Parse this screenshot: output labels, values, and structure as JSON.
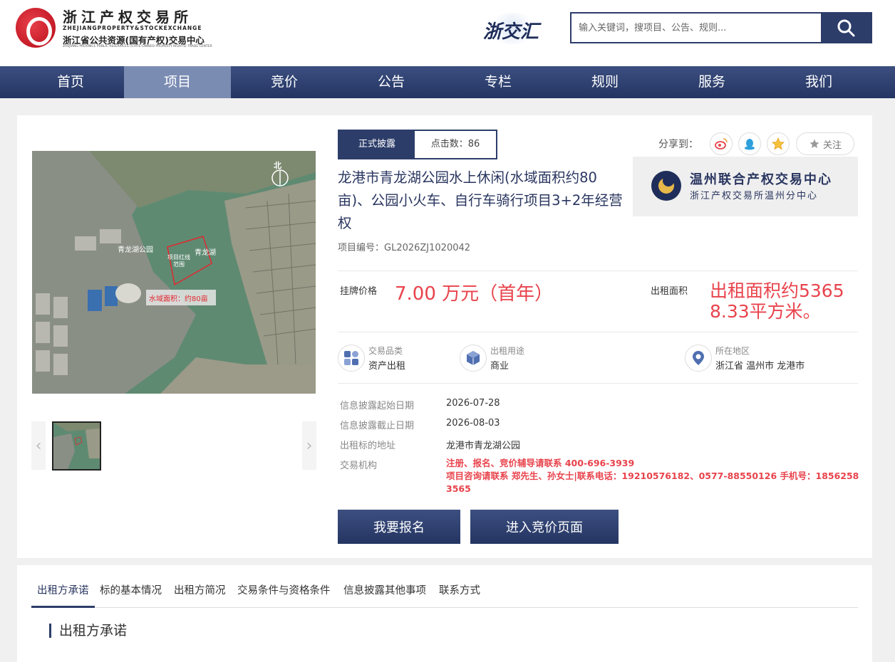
{
  "header": {
    "logo_cn": "浙江产权交易所",
    "logo_en": "ZHEJIANGPROPERTY&STOCKEXCHANGE",
    "logo_sub": "浙江省公共资源(国有产权)交易中心",
    "logo_sub_en": "ZHEJIANG PROVINCE PUBLIC RESOURCES (STATE-OWNED PROPERTY RIGHTS) TRADE CENTER",
    "zjh": "浙交汇",
    "search_placeholder": "输入关键词，搜项目、公告、规则..."
  },
  "nav": {
    "items": [
      {
        "label": "首页",
        "active": false
      },
      {
        "label": "项目",
        "active": true
      },
      {
        "label": "竞价",
        "active": false
      },
      {
        "label": "公告",
        "active": false
      },
      {
        "label": "专栏",
        "active": false
      },
      {
        "label": "规则",
        "active": false
      },
      {
        "label": "服务",
        "active": false
      },
      {
        "label": "我们",
        "active": false
      }
    ]
  },
  "image": {
    "north": "北",
    "label_park": "青龙湖公园",
    "label_lake": "青龙湖",
    "label_red": "项目红线范围",
    "label_water": "水域面积：约80亩"
  },
  "project": {
    "tag": "正式披露",
    "clicks": "点击数：86",
    "title": "龙港市青龙湖公园水上休闲(水域面积约80亩)、公园小火车、自行车骑行项目3+2年经营权",
    "code": "项目编号：GL2026ZJ1020042",
    "price_label": "挂牌价格",
    "price_value": "7.00 万元（首年）",
    "area_label": "出租面积",
    "area_value": "出租面积约53658.33平方米。"
  },
  "share": {
    "label": "分享到：",
    "follow": "关注"
  },
  "center": {
    "name": "温州联合产权交易中心",
    "sub": "浙江产权交易所温州分中心"
  },
  "attrs": [
    {
      "label": "交易品类",
      "value": "资产出租"
    },
    {
      "label": "出租用途",
      "value": "商业"
    },
    {
      "label": "所在地区",
      "value": "浙江省 温州市 龙港市"
    }
  ],
  "info": {
    "start_label": "信息披露起始日期",
    "start_value": "2026-07-28",
    "end_label": "信息披露截止日期",
    "end_value": "2026-08-03",
    "addr_label": "出租标的地址",
    "addr_value": "龙港市青龙湖公园",
    "org_label": "交易机构",
    "org_line1": "注册、报名、竞价辅导请联系 400-696-3939",
    "org_line2": "项目咨询请联系 郑先生、孙女士|联系电话：19210576182、0577-88550126 手机号：18562583565"
  },
  "buttons": {
    "signup": "我要报名",
    "bid": "进入竞价页面"
  },
  "tabs": [
    "出租方承诺",
    "标的基本情况",
    "出租方简况",
    "交易条件与资格条件",
    "信息披露其他事项",
    "联系方式"
  ],
  "section_title": "出租方承诺",
  "colors": {
    "primary": "#2d3d6a",
    "accent_red": "#e8434c",
    "nav_active": "#7b8cb3"
  }
}
